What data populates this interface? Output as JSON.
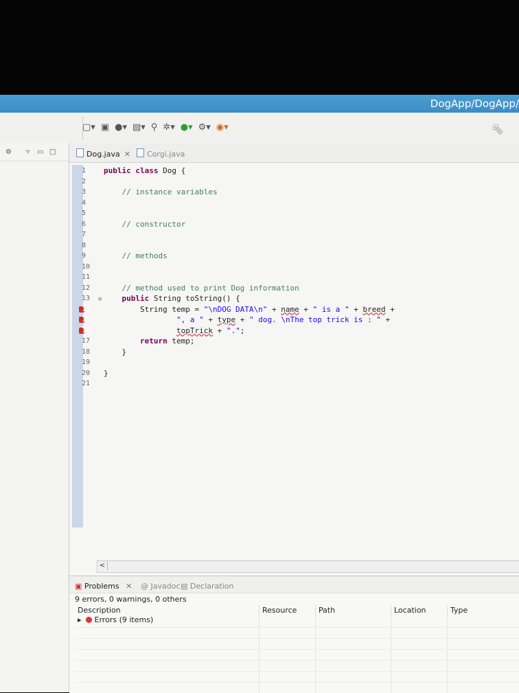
{
  "window": {
    "title": "DogApp/DogApp/"
  },
  "toolbar": {
    "icons": [
      "new-icon",
      "save-icon",
      "debug-icon",
      "run-icon",
      "search-icon",
      "perspective-icon"
    ]
  },
  "left_panel": {
    "controls": [
      "▿",
      "▭",
      "□"
    ]
  },
  "editor": {
    "tabs": [
      {
        "label": "Dog.java",
        "close": "✕",
        "active": true
      },
      {
        "label": "Corgi.java",
        "active": false
      }
    ],
    "lines": [
      {
        "n": "1",
        "html": "<span class='kw'>public class</span> Dog {"
      },
      {
        "n": "2",
        "html": ""
      },
      {
        "n": "3",
        "html": "    <span class='cm'>// instance variables</span>"
      },
      {
        "n": "4",
        "html": ""
      },
      {
        "n": "5",
        "html": ""
      },
      {
        "n": "6",
        "html": "    <span class='cm'>// constructor</span>"
      },
      {
        "n": "7",
        "html": ""
      },
      {
        "n": "8",
        "html": ""
      },
      {
        "n": "9",
        "html": "    <span class='cm'>// methods</span>"
      },
      {
        "n": "10",
        "html": ""
      },
      {
        "n": "11",
        "html": ""
      },
      {
        "n": "12",
        "html": "    <span class='cm'>// method used to print Dog information</span>"
      },
      {
        "n": "13",
        "html": "    <span class='kw'>public</span> String toString() {",
        "fold": true
      },
      {
        "n": "14",
        "html": "        String temp = <span class='st'>\"\\nDOG DATA\\n\"</span> + <span class='er'>name</span> + <span class='st'>\" is a \"</span> + <span class='er'>breed</span> +",
        "error": true
      },
      {
        "n": "15",
        "html": "                <span class='st'>\", a \"</span> + <span class='er'>type</span> + <span class='st'>\" dog. \\nThe top trick is : \"</span> +",
        "error": true
      },
      {
        "n": "16",
        "html": "                <span class='er'>topTrick</span> + <span class='st'>\".\"</span>;",
        "error": true
      },
      {
        "n": "17",
        "html": "        <span class='kw'>return</span> temp;"
      },
      {
        "n": "18",
        "html": "    }"
      },
      {
        "n": "19",
        "html": ""
      },
      {
        "n": "20",
        "html": "}"
      },
      {
        "n": "21",
        "html": ""
      }
    ]
  },
  "problems": {
    "tabs": [
      {
        "label": "Problems",
        "close": "✕"
      },
      {
        "label": "Javadoc"
      },
      {
        "label": "Declaration"
      }
    ],
    "summary": "9 errors, 0 warnings, 0 others",
    "columns": [
      "Description",
      "Resource",
      "Path",
      "Location",
      "Type"
    ],
    "error_group": "Errors (9 items)"
  },
  "colors": {
    "titlebar": "#3b8cc4",
    "keyword": "#7a0055",
    "comment": "#3f7f5f",
    "string": "#2a00ff",
    "error": "#c9302c"
  }
}
